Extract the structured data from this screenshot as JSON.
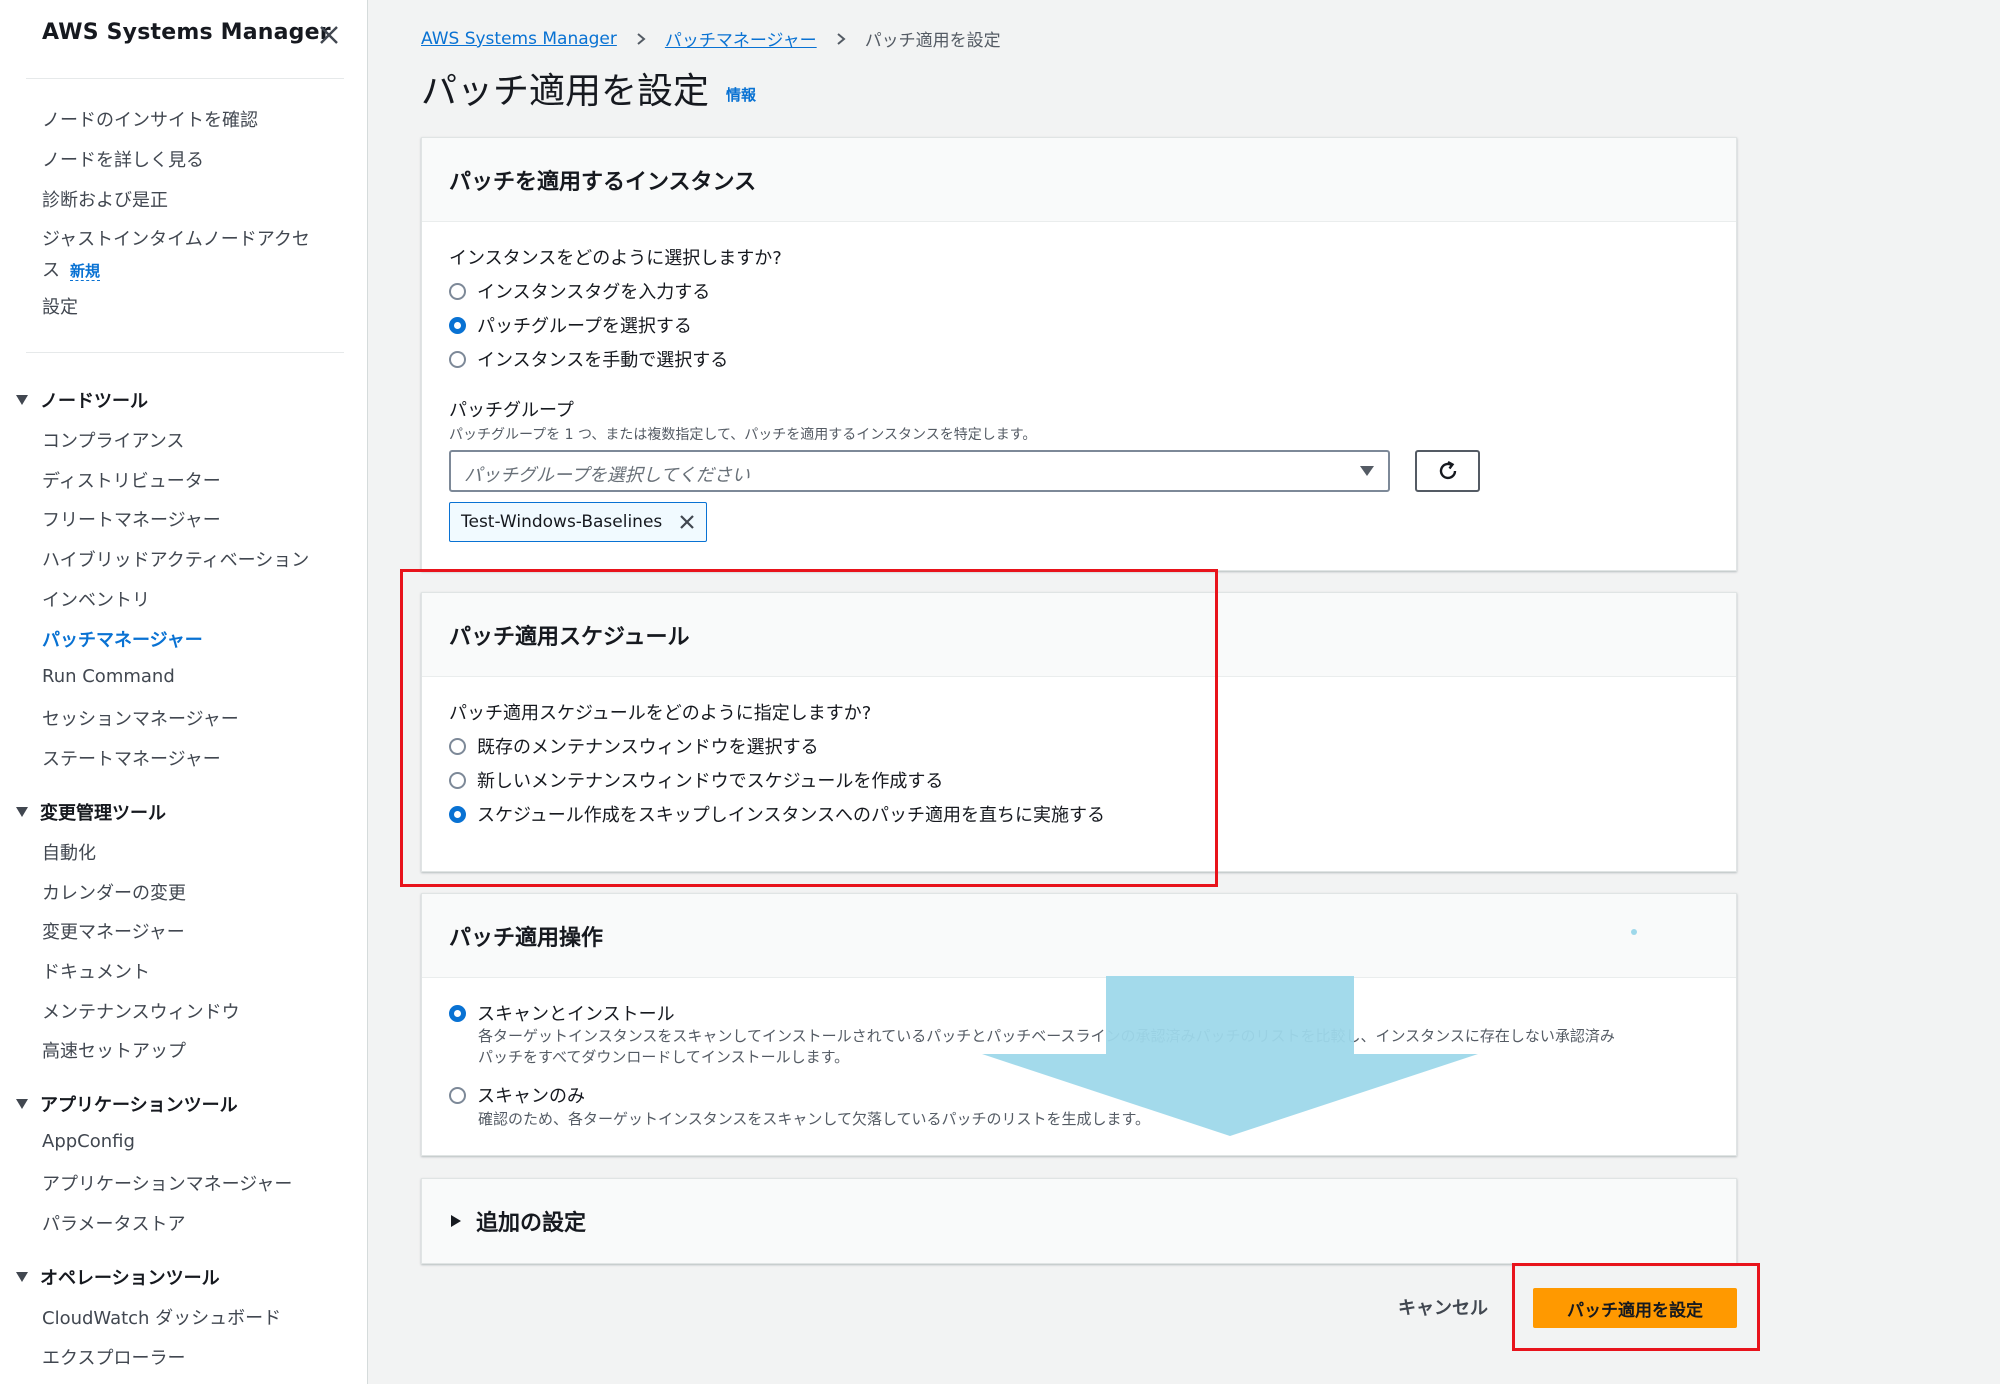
{
  "sidebar": {
    "title": "AWS Systems Manager",
    "top_items": [
      {
        "label": "ノードのインサイトを確認"
      },
      {
        "label": "ノードを詳しく見る"
      },
      {
        "label": "診断および是正"
      },
      {
        "label_line1": "ジャストインタイムノードアクセ",
        "label_line2": "ス",
        "badge": "新規"
      },
      {
        "label": "設定"
      }
    ],
    "sections": [
      {
        "title": "ノードツール",
        "items": [
          "コンプライアンス",
          "ディストリビューター",
          "フリートマネージャー",
          "ハイブリッドアクティベーション",
          "インベントリ",
          "パッチマネージャー",
          "Run Command",
          "セッションマネージャー",
          "ステートマネージャー"
        ]
      },
      {
        "title": "変更管理ツール",
        "items": [
          "自動化",
          "カレンダーの変更",
          "変更マネージャー",
          "ドキュメント",
          "メンテナンスウィンドウ",
          "高速セットアップ"
        ]
      },
      {
        "title": "アプリケーションツール",
        "items": [
          "AppConfig",
          "アプリケーションマネージャー",
          "パラメータストア"
        ]
      },
      {
        "title": "オペレーションツール",
        "items": [
          "CloudWatch ダッシュボード",
          "エクスプローラー"
        ]
      }
    ],
    "active_item": "パッチマネージャー"
  },
  "breadcrumb": [
    "AWS Systems Manager",
    "パッチマネージャー",
    "パッチ適用を設定"
  ],
  "page": {
    "title": "パッチ適用を設定",
    "info": "情報"
  },
  "instances_panel": {
    "header": "パッチを適用するインスタンス",
    "question": "インスタンスをどのように選択しますか?",
    "options": [
      "インスタンスタグを入力する",
      "パッチグループを選択する",
      "インスタンスを手動で選択する"
    ],
    "selected_index": 1,
    "field_label": "パッチグループ",
    "field_description": "パッチグループを 1 つ、または複数指定して、パッチを適用するインスタンスを特定します。",
    "select_placeholder": "パッチグループを選択してください",
    "token": "Test-Windows-Baselines"
  },
  "schedule_panel": {
    "header": "パッチ適用スケジュール",
    "question": "パッチ適用スケジュールをどのように指定しますか?",
    "options": [
      "既存のメンテナンスウィンドウを選択する",
      "新しいメンテナンスウィンドウでスケジュールを作成する",
      "スケジュール作成をスキップしインスタンスへのパッチ適用を直ちに実施する"
    ],
    "selected_index": 2
  },
  "operation_panel": {
    "header": "パッチ適用操作",
    "options": [
      {
        "label": "スキャンとインストール",
        "desc_line1": "各ターゲットインスタンスをスキャンしてインストールされているパッチとパッチベースラインの承認済みパッチのリストを比較し、インスタンスに存在しない承認済み",
        "desc_line2": "パッチをすべてダウンロードしてインストールします。"
      },
      {
        "label": "スキャンのみ",
        "desc_line1": "確認のため、各ターゲットインスタンスをスキャンして欠落しているパッチのリストを生成します。"
      }
    ],
    "selected_index": 0
  },
  "additional_settings": {
    "label": "追加の設定"
  },
  "footer": {
    "cancel": "キャンセル",
    "submit": "パッチ適用を設定"
  },
  "colors": {
    "link": "#0972d3",
    "primary_button": "#ff9900",
    "annotation_box": "#e8131b",
    "annotation_arrow": "#9ed8ea"
  },
  "icons": {
    "close": "close-icon",
    "breadcrumb_sep": "chevron-right-icon",
    "refresh": "refresh-icon",
    "dropdown": "caret-down-icon",
    "token_remove": "close-icon",
    "expand": "caret-right-icon"
  }
}
